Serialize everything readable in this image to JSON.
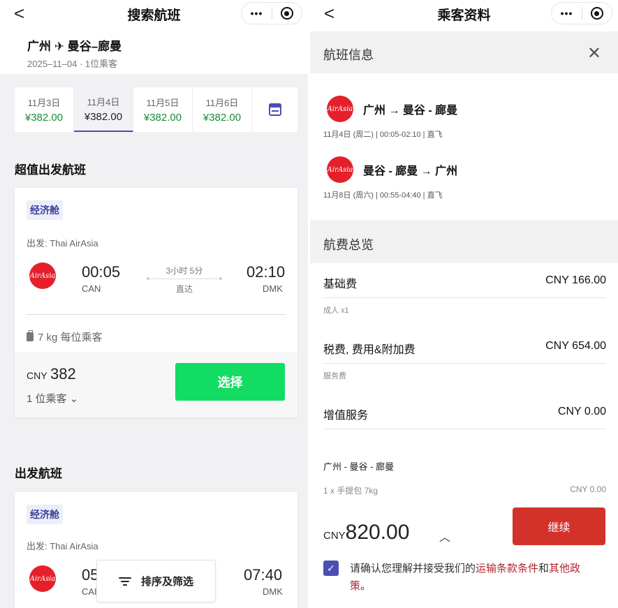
{
  "left": {
    "nav": {
      "back": "<",
      "title": "搜索航班",
      "more": "•••"
    },
    "route": {
      "title": "广州 ✈ 曼谷–廊曼",
      "subtitle": "2025–11–04 · 1位乘客"
    },
    "dates": [
      {
        "date": "11月3日",
        "price": "¥382.00"
      },
      {
        "date": "11月4日",
        "price": "¥382.00"
      },
      {
        "date": "11月5日",
        "price": "¥382.00"
      },
      {
        "date": "11月6日",
        "price": "¥382.00"
      }
    ],
    "section1_title": "超值出发航班",
    "card1": {
      "cabin": "经济舱",
      "depart_by": "出发: Thai AirAsia",
      "logo": "AirAsia",
      "dep_time": "00:05",
      "dep_code": "CAN",
      "duration": "3小时 5分",
      "stops": "直达",
      "arr_time": "02:10",
      "arr_code": "DMK",
      "baggage": "7 kg  每位乘客",
      "price_cur": "CNY",
      "price_num": "382",
      "pax": "1 位乘客 ⌄",
      "select": "选择"
    },
    "section2_title": "出发航班",
    "card2": {
      "cabin": "经济舱",
      "depart_by": "出发: Thai AirAsia",
      "logo": "AirAsia",
      "dep_time": "05",
      "dep_code": "CAI",
      "arr_time": "07:40",
      "arr_code": "DMK"
    },
    "sort_filter": "排序及筛选"
  },
  "right": {
    "nav": {
      "back": "<",
      "title": "乘客资料",
      "more": "•••"
    },
    "flight_info_title": "航班信息",
    "close": "✕",
    "flights": [
      {
        "logo": "AirAsia",
        "route": "广州 → 曼谷 - 廊曼",
        "meta": "11月4日 (周二) | 00:05-02:10 | 直飞"
      },
      {
        "logo": "AirAsia",
        "route": "曼谷 - 廊曼 → 广州",
        "meta": "11月8日 (周六) | 00:55-04:40 | 直飞"
      }
    ],
    "fare_title": "航费总览",
    "fees": [
      {
        "label": "基础费",
        "value": "CNY  166.00",
        "note": "成人 x1"
      },
      {
        "label": "税费, 费用&附加费",
        "value": "CNY  654.00",
        "note": "服务费"
      },
      {
        "label": "增值服务",
        "value": "CNY  0.00",
        "note": ""
      }
    ],
    "addon_route": "广州 - 曼谷 - 廊曼",
    "addon_item": "1 x 手提包 7kg",
    "addon_value": "CNY  0.00",
    "total_cur": "CNY",
    "total_num": "820.00",
    "continue": "继续",
    "terms_pre": "请确认您理解并接受我们的",
    "terms_link1": "运输条款条件",
    "terms_and": "和",
    "terms_link2": "其他政策",
    "terms_end": "。"
  }
}
